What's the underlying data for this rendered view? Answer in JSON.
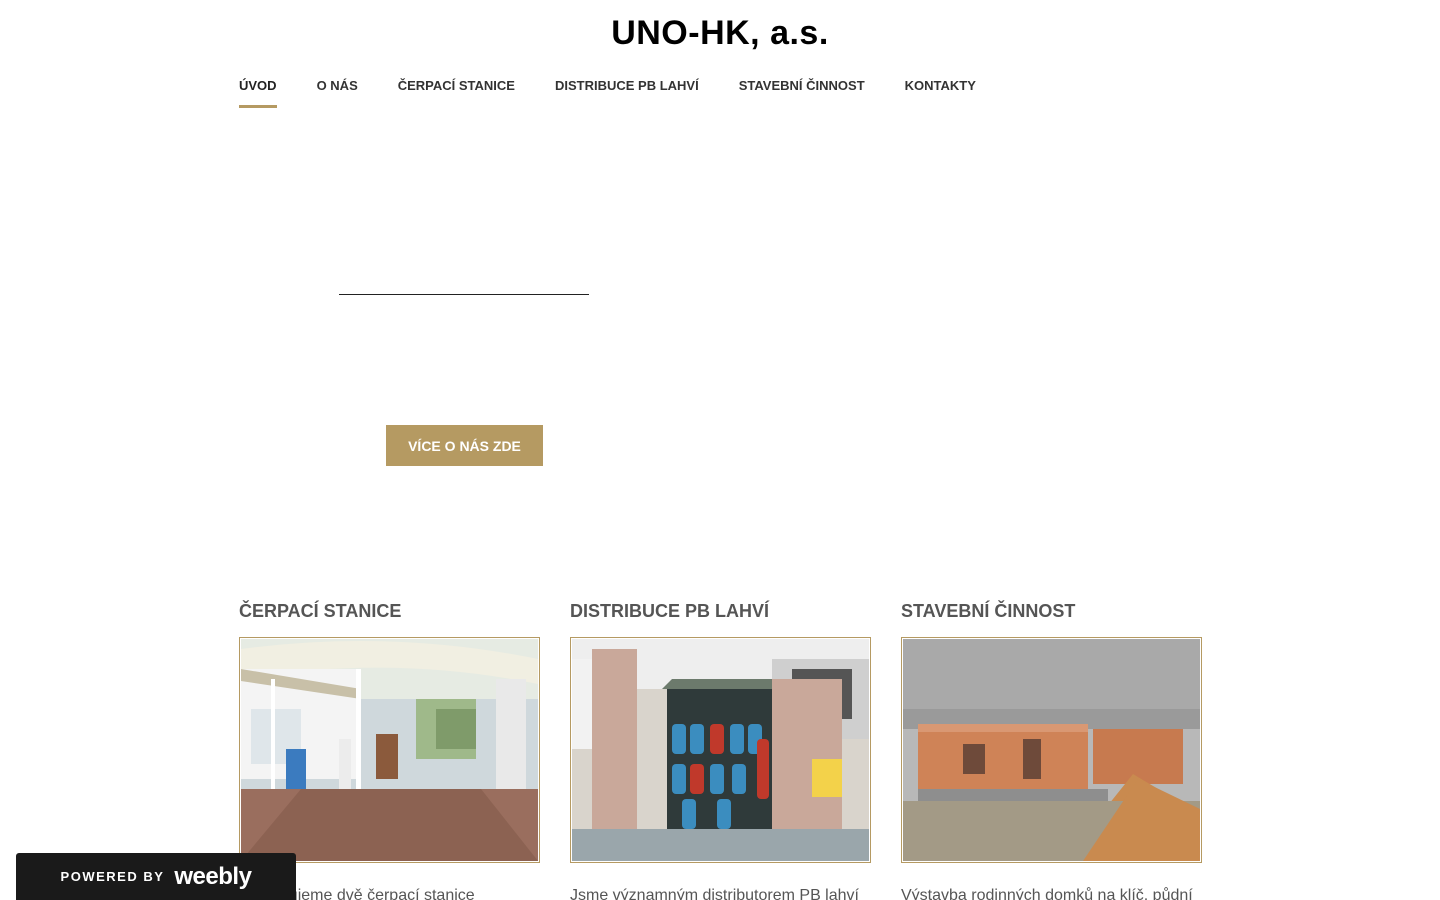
{
  "site": {
    "title": "UNO-HK, a.s."
  },
  "nav": {
    "items": [
      {
        "label": "ÚVOD",
        "active": true
      },
      {
        "label": "O NÁS",
        "active": false
      },
      {
        "label": "ČERPACÍ STANICE",
        "active": false
      },
      {
        "label": "DISTRIBUCE PB LAHVÍ",
        "active": false
      },
      {
        "label": "STAVEBNÍ ČINNOST",
        "active": false
      },
      {
        "label": "KONTAKTY",
        "active": false
      }
    ]
  },
  "hero": {
    "button_label": "VÍCE O NÁS ZDE"
  },
  "columns": [
    {
      "title": "ČERPACÍ STANICE",
      "text": "Provozujeme dvě čerpací stanice"
    },
    {
      "title": "DISTRIBUCE PB LAHVÍ",
      "text": "Jsme významným distributorem PB lahví"
    },
    {
      "title": "STAVEBNÍ ČINNOST",
      "text": "Výstavba rodinných domků na klíč, půdní"
    }
  ],
  "badge": {
    "powered_by": "POWERED BY",
    "brand": "weebly"
  },
  "colors": {
    "accent": "#b59a62",
    "badge_bg": "#1a1a1a"
  }
}
